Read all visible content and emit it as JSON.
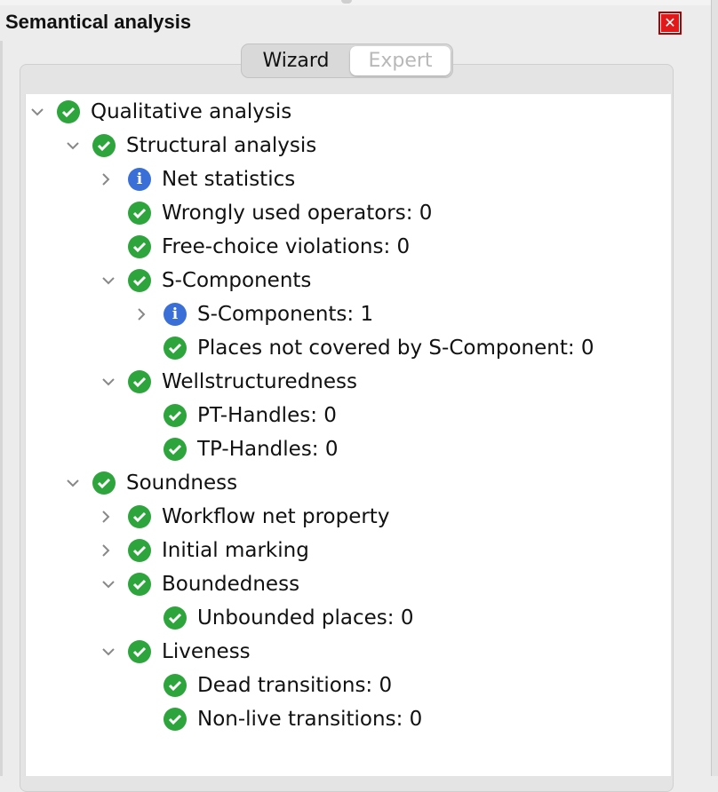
{
  "panel": {
    "title": "Semantical analysis",
    "close_label": "✕"
  },
  "tabs": [
    {
      "label": "Wizard",
      "selected": true
    },
    {
      "label": "Expert",
      "selected": false
    }
  ],
  "tree": [
    {
      "label": "Qualitative analysis",
      "icon": "check-icon",
      "toggle": "expanded"
    },
    {
      "label": "Structural analysis",
      "icon": "check-icon",
      "toggle": "expanded"
    },
    {
      "label": "Net statistics",
      "icon": "info-icon",
      "toggle": "collapsed"
    },
    {
      "label": "Wrongly used operators: 0",
      "icon": "check-icon",
      "toggle": "none"
    },
    {
      "label": "Free-choice violations: 0",
      "icon": "check-icon",
      "toggle": "none"
    },
    {
      "label": "S-Components",
      "icon": "check-icon",
      "toggle": "expanded"
    },
    {
      "label": "S-Components: 1",
      "icon": "info-icon",
      "toggle": "collapsed"
    },
    {
      "label": "Places not covered by S-Component: 0",
      "icon": "check-icon",
      "toggle": "none"
    },
    {
      "label": "Wellstructuredness",
      "icon": "check-icon",
      "toggle": "expanded"
    },
    {
      "label": "PT-Handles: 0",
      "icon": "check-icon",
      "toggle": "none"
    },
    {
      "label": "TP-Handles: 0",
      "icon": "check-icon",
      "toggle": "none"
    },
    {
      "label": "Soundness",
      "icon": "check-icon",
      "toggle": "expanded"
    },
    {
      "label": "Workflow net property",
      "icon": "check-icon",
      "toggle": "collapsed"
    },
    {
      "label": "Initial marking",
      "icon": "check-icon",
      "toggle": "collapsed"
    },
    {
      "label": "Boundedness",
      "icon": "check-icon",
      "toggle": "expanded"
    },
    {
      "label": "Unbounded places: 0",
      "icon": "check-icon",
      "toggle": "none"
    },
    {
      "label": "Liveness",
      "icon": "check-icon",
      "toggle": "expanded"
    },
    {
      "label": "Dead transitions: 0",
      "icon": "check-icon",
      "toggle": "none"
    },
    {
      "label": "Non-live transitions: 0",
      "icon": "check-icon",
      "toggle": "none"
    }
  ],
  "colors": {
    "check": "#2ea43c",
    "info": "#3a6fd8",
    "close": "#e01a1a"
  }
}
